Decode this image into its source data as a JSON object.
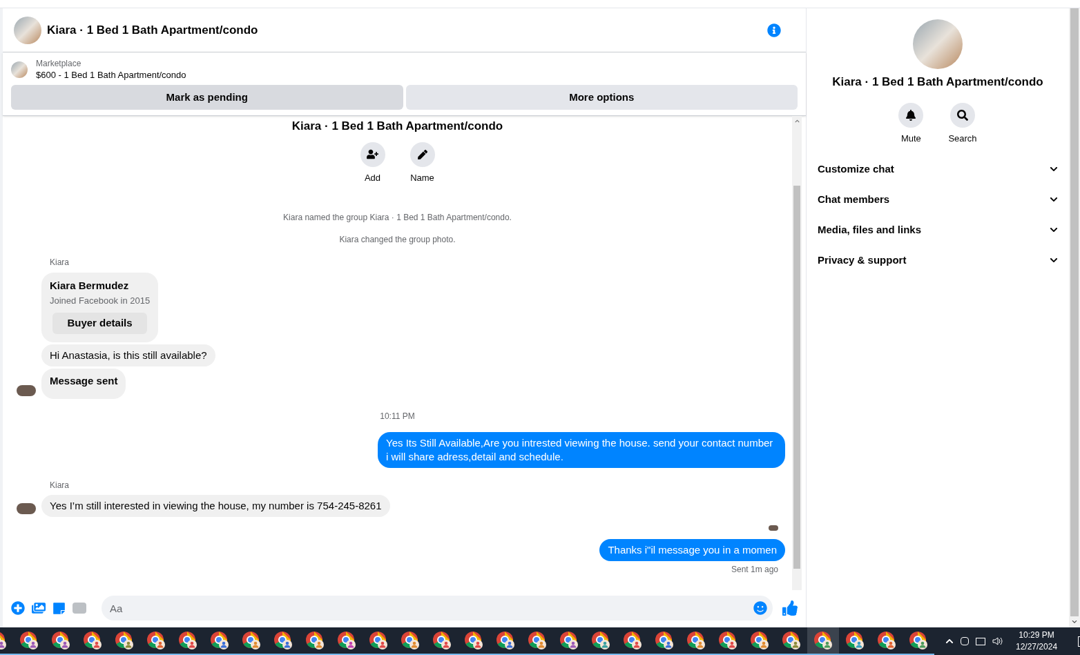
{
  "header": {
    "title": "Kiara · 1 Bed 1 Bath Apartment/condo"
  },
  "listing": {
    "source": "Marketplace",
    "title": "$600 - 1 Bed 1 Bath Apartment/condo",
    "buttons": [
      "Mark as pending",
      "More options"
    ]
  },
  "conversation_intro": {
    "title": "Kiara · 1 Bed 1 Bath Apartment/condo",
    "actions": [
      "Add",
      "Name"
    ],
    "events": [
      "Kiara named the group Kiara · 1 Bed 1 Bath Apartment/condo.",
      "Kiara changed the group photo."
    ]
  },
  "messages": [
    {
      "kind": "sender",
      "text": "Kiara"
    },
    {
      "kind": "buyer_card",
      "name": "Kiara Bermudez",
      "subtitle": "Joined Facebook in 2015",
      "button": "Buyer details"
    },
    {
      "kind": "incoming",
      "text": "Hi Anastasia, is this still available?",
      "avatar": false
    },
    {
      "kind": "incoming_bold",
      "text": "Message sent",
      "avatar": true
    },
    {
      "kind": "time",
      "text": "10:11 PM"
    },
    {
      "kind": "outgoing",
      "text": "Yes Its Still Available,Are you intrested viewing the house. send your contact number i will share adress,detail and schedule."
    },
    {
      "kind": "sender",
      "text": "Kiara"
    },
    {
      "kind": "incoming",
      "text": "Yes I’m still interested in viewing the house, my number is 754-245-8261",
      "avatar": true
    },
    {
      "kind": "seen"
    },
    {
      "kind": "outgoing",
      "text": "Thanks i\"il message you in a momen"
    },
    {
      "kind": "status",
      "text": "Sent 1m ago"
    }
  ],
  "composer": {
    "placeholder": "Aa"
  },
  "details_panel": {
    "title": "Kiara · 1 Bed 1 Bath Apartment/condo",
    "actions": [
      {
        "kind": "mute",
        "label": "Mute"
      },
      {
        "kind": "search",
        "label": "Search"
      }
    ],
    "sections": [
      {
        "label": "Customize chat",
        "expanded": false
      },
      {
        "label": "Chat members",
        "expanded": false
      },
      {
        "label": "Media, files and links",
        "expanded": false
      },
      {
        "label": "Privacy & support",
        "expanded": false
      }
    ]
  },
  "taskbar": {
    "apps": [
      {
        "color": "#9b59b6",
        "selected": false
      },
      {
        "color": "#9b59b6",
        "selected": false
      },
      {
        "color": "#9b59b6",
        "selected": false
      },
      {
        "color": "#e04848",
        "selected": false
      },
      {
        "color": "#8a8a3a",
        "selected": false
      },
      {
        "color": "#e06030",
        "selected": false
      },
      {
        "color": "#e04848",
        "selected": false
      },
      {
        "color": "#3a6fd8",
        "selected": false
      },
      {
        "color": "#e08a30",
        "selected": false
      },
      {
        "color": "#3a6fd8",
        "selected": false
      },
      {
        "color": "#e08a30",
        "selected": false
      },
      {
        "color": "#c040b0",
        "selected": false
      },
      {
        "color": "#e04848",
        "selected": false
      },
      {
        "color": "#e08a30",
        "selected": false
      },
      {
        "color": "#e04848",
        "selected": false
      },
      {
        "color": "#e04848",
        "selected": false
      },
      {
        "color": "#3a6fd8",
        "selected": false
      },
      {
        "color": "#e08a30",
        "selected": false
      },
      {
        "color": "#9b59b6",
        "selected": false
      },
      {
        "color": "#3aa0a0",
        "selected": false
      },
      {
        "color": "#e04848",
        "selected": false
      },
      {
        "color": "#3a6fd8",
        "selected": false
      },
      {
        "color": "#e08a30",
        "selected": false
      },
      {
        "color": "#e04848",
        "selected": false
      },
      {
        "color": "#e08a30",
        "selected": false
      },
      {
        "color": "#8a8a3a",
        "selected": false
      },
      {
        "color": "#4a9a5a",
        "selected": true
      },
      {
        "color": "#3aa0c0",
        "selected": false
      },
      {
        "color": "#e06030",
        "selected": false
      },
      {
        "color": "#4a9a5a",
        "selected": false
      }
    ],
    "time": "10:29 PM",
    "date": "12/27/2024"
  }
}
